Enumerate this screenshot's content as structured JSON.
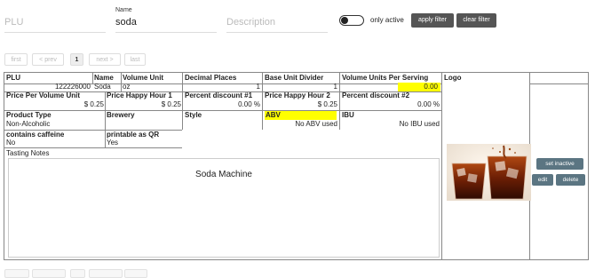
{
  "filters": {
    "plu": {
      "value": "",
      "placeholder": "PLU"
    },
    "name": {
      "label": "Name",
      "value": "soda",
      "placeholder": "Name"
    },
    "description": {
      "value": "",
      "placeholder": "Description"
    },
    "only_active_label": "only active",
    "apply_label": "apply filter",
    "clear_label": "clear filter"
  },
  "pager": {
    "first": "first",
    "prev": "< prev",
    "page": "1",
    "next": "next >",
    "last": "last"
  },
  "record": {
    "headers": {
      "plu": "PLU",
      "name": "Name",
      "volume_unit": "Volume Unit",
      "decimal_places": "Decimal Places",
      "base_unit_divider": "Base Unit Divider",
      "volume_units_per_serving": "Volume Units Per Serving",
      "logo": "Logo",
      "price_per_volume_unit": "Price Per Volume Unit",
      "price_happy_hour_1": "Price Happy Hour 1",
      "percent_discount_1": "Percent discount #1",
      "price_happy_hour_2": "Price Happy Hour 2",
      "percent_discount_2": "Percent discount #2",
      "product_type": "Product Type",
      "brewery": "Brewery",
      "style": "Style",
      "abv": "ABV",
      "ibu": "IBU",
      "contains_caffeine": "contains caffeine",
      "printable_as_qr": "printable as QR",
      "tasting_notes": "Tasting Notes"
    },
    "values": {
      "plu": "122226000",
      "name": "Soda",
      "volume_unit": "oz",
      "decimal_places": "1",
      "base_unit_divider": "1",
      "volume_units_per_serving": "0.00",
      "price_per_volume_unit": "$ 0.25",
      "price_happy_hour_1": "$ 0.25",
      "percent_discount_1": "0.00 %",
      "price_happy_hour_2": "$ 0.25",
      "percent_discount_2": "0.00 %",
      "product_type": "Non-Alcoholic",
      "brewery": "",
      "style": "",
      "abv": "No ABV used",
      "ibu": "No IBU used",
      "contains_caffeine": "No",
      "printable_as_qr": "Yes",
      "tasting_notes": "Soda Machine"
    },
    "logo_icon": "soda-glasses-photo",
    "actions": {
      "set_inactive": "set inactive",
      "edit": "edit",
      "delete": "delete"
    }
  },
  "colors": {
    "highlight": "#ffff00",
    "dark_button": "#555555",
    "action_button": "#5b7582"
  }
}
